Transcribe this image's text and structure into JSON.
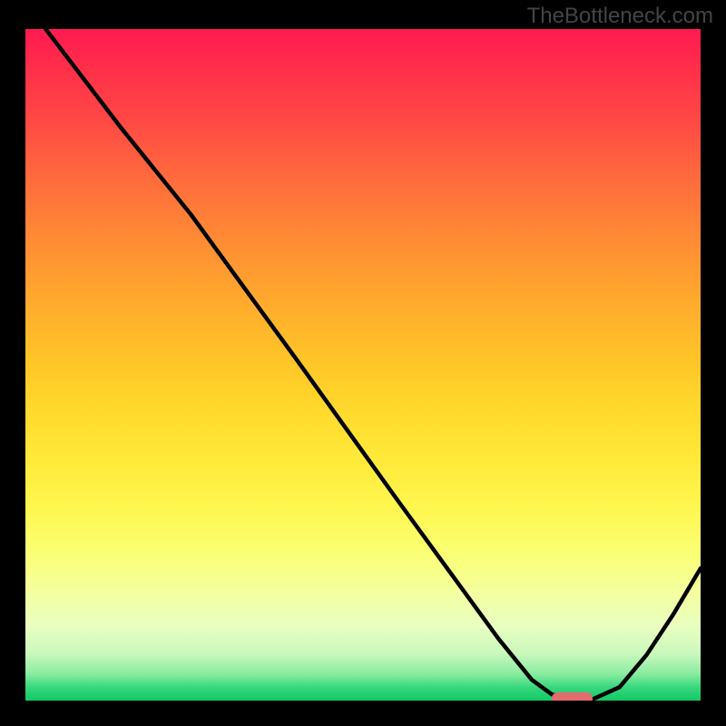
{
  "domain": "Chart",
  "watermark": "TheBottleneck.com",
  "colors": {
    "page_bg": "#000000",
    "curve": "#000000",
    "marker": "#e46b6b",
    "watermark": "#444444"
  },
  "chart_data": {
    "type": "line",
    "title": "",
    "xlabel": "",
    "ylabel": "",
    "xlim": [
      0,
      100
    ],
    "ylim": [
      0,
      100
    ],
    "note": "Axes are unlabeled percent-of-plot coordinates; y-values are inverted (0 at bottom, 100 at top).",
    "series": [
      {
        "name": "bottleneck-curve",
        "x": [
          3,
          14,
          24.5,
          40,
          55,
          70,
          75,
          78,
          81.6,
          84,
          88,
          92,
          96,
          100
        ],
        "values": [
          100,
          85.5,
          72.4,
          51,
          30,
          9.3,
          3.1,
          0.9,
          0.2,
          0.2,
          2.0,
          6.8,
          12.9,
          19.7
        ]
      }
    ],
    "optimal_range": {
      "x_start": 78,
      "x_end": 84,
      "y": 0.4
    }
  }
}
